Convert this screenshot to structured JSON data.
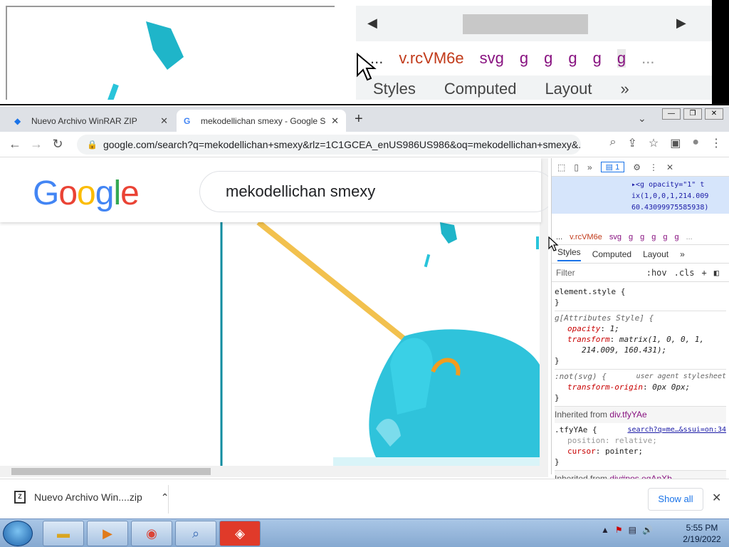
{
  "magnifier": {
    "crumbs": [
      "...",
      "v.rcVM6e",
      "svg",
      "g",
      "g",
      "g",
      "g",
      "g",
      "..."
    ],
    "tabs": [
      "Styles",
      "Computed",
      "Layout",
      "»"
    ],
    "scroll_left": "◀",
    "scroll_right": "▶"
  },
  "tabs": [
    {
      "title": "Nuevo Archivo WinRAR ZIP",
      "close": "✕"
    },
    {
      "title": "mekodellichan smexy - Google S",
      "close": "✕"
    }
  ],
  "newtab": "+",
  "tab_dropdown": "⌄",
  "window_controls": [
    "—",
    "❐",
    "✕"
  ],
  "toolbar": {
    "back": "←",
    "forward": "→",
    "reload": "↻",
    "url": "google.com/search?q=mekodellichan+smexy&rlz=1C1GCEA_enUS986US986&oq=mekodellichan+smexy&...",
    "icons": [
      "⌕",
      "⇪",
      "☆",
      "▣",
      "●",
      "⋮"
    ]
  },
  "google": {
    "logo_letters": [
      "G",
      "o",
      "o",
      "g",
      "l",
      "e"
    ],
    "logo_colors": [
      "#4285F4",
      "#EA4335",
      "#FBBC05",
      "#4285F4",
      "#34A853",
      "#EA4335"
    ],
    "query": "mekodellichan smexy"
  },
  "devtools": {
    "top_icons": [
      "⬚",
      "▯",
      "»",
      "⚙",
      "⋮",
      "✕"
    ],
    "badge": "1",
    "code_lines": [
      "▸<g opacity=\"1\" t",
      "ix(1,0,0,1,214.009",
      "60.43099975585938)"
    ],
    "crumbs": [
      "...",
      "v.rcVM6e",
      "svg",
      "g",
      "g",
      "g",
      "g",
      "g",
      "..."
    ],
    "tabs": [
      "Styles",
      "Computed",
      "Layout",
      "»"
    ],
    "filter_placeholder": "Filter",
    "hov": ":hov",
    "cls": ".cls",
    "plus": "+",
    "rules": {
      "element_style": "element.style {",
      "close": "}",
      "attr_selector": "g[Attributes Style] {",
      "opacity_name": "opacity",
      "opacity_value": "1;",
      "transform_name": "transform",
      "transform_value": "matrix(1, 0, 0, 1,",
      "transform_value2": "214.009, 160.431);",
      "not_svg": ":not(svg) {",
      "ua_label": "user agent stylesheet",
      "origin_name": "transform-origin",
      "origin_value": "0px 0px;",
      "inherited_label": "Inherited from",
      "inherited_from": "div.tfyYAe",
      "tfy_selector": ".tfyYAe {",
      "tfy_link": "search?q=me…&ssui=on:34",
      "position_name": "position",
      "position_value": "relative;",
      "cursor_name": "cursor",
      "cursor_value": "pointer;",
      "inherited_label2": "Inherited from",
      "inherited_from2": "div#pos eqAnXb"
    }
  },
  "download": {
    "icon_text": "Z",
    "filename": "Nuevo Archivo Win....zip",
    "chevron": "⌃",
    "show_all": "Show all",
    "close": "✕"
  },
  "taskbar": {
    "time": "5:55 PM",
    "date": "2/19/2022",
    "tray_icons": [
      "▲",
      "⚑",
      "▤",
      "🔊"
    ]
  }
}
